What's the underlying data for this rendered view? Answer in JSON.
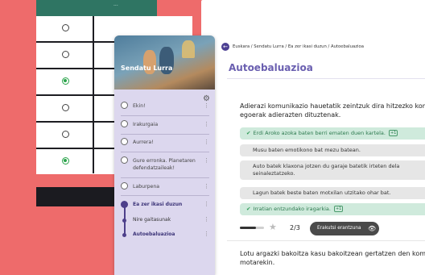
{
  "table": {
    "header_text": "...",
    "rows": [
      {
        "selected": false
      },
      {
        "selected": false
      },
      {
        "selected": true
      },
      {
        "selected": false
      },
      {
        "selected": false
      },
      {
        "selected": true
      }
    ]
  },
  "sidebar": {
    "banner_title": "Sendatu Lurra",
    "items": [
      {
        "label": "Ekin!"
      },
      {
        "label": "Irakurgaia"
      },
      {
        "label": "Aurrera!"
      },
      {
        "label": "Gure erronka. Planetaren defendatzaileak!"
      },
      {
        "label": "Laburpena"
      }
    ],
    "active_section": {
      "label": "Ea zer ikasi duzun",
      "children": [
        {
          "label": "Nire gaitasunak"
        },
        {
          "label": "Autoebaluazioa"
        }
      ]
    }
  },
  "breadcrumb": "Euskara / Sendatu Lurra / Ea zer ikasi duzun / Autoebaluazioa",
  "page_title": "Autoebaluazioa",
  "question1": {
    "line1": "Adierazi komunikazio hauetatik zeintzuk dira hitzezko kom",
    "line2": "egoerak adierazten dituztenak."
  },
  "options": [
    {
      "text": "Erdi Aroko azoka baten berri ematen duen kartela.",
      "correct": true,
      "badge": "+1"
    },
    {
      "text": "Musu baten emotikono bat mezu batean.",
      "correct": false
    },
    {
      "text_line1": "Auto batek klaxona jotzen du garaje batetik irteten dela",
      "text_line2": "seinaleztatzeko.",
      "correct": false
    },
    {
      "text": "Lagun batek beste baten motxilan utzitako ohar bat.",
      "correct": false
    },
    {
      "text": "Irratian entzundako iragarkia.",
      "correct": true,
      "badge": "+1"
    }
  ],
  "progress": {
    "score_text": "2/3",
    "fraction": 0.67
  },
  "show_answer_label": "Erakutsi erantzuna",
  "question2": {
    "line1": "Lotu argazki bakoitza kasu bakoitzean gertatzen den kom",
    "line2": "motarekin."
  },
  "colors": {
    "background": "#ee6b6b",
    "accent": "#4c3f92",
    "title": "#6a5fb0",
    "correct_bg": "#cfeadc"
  }
}
